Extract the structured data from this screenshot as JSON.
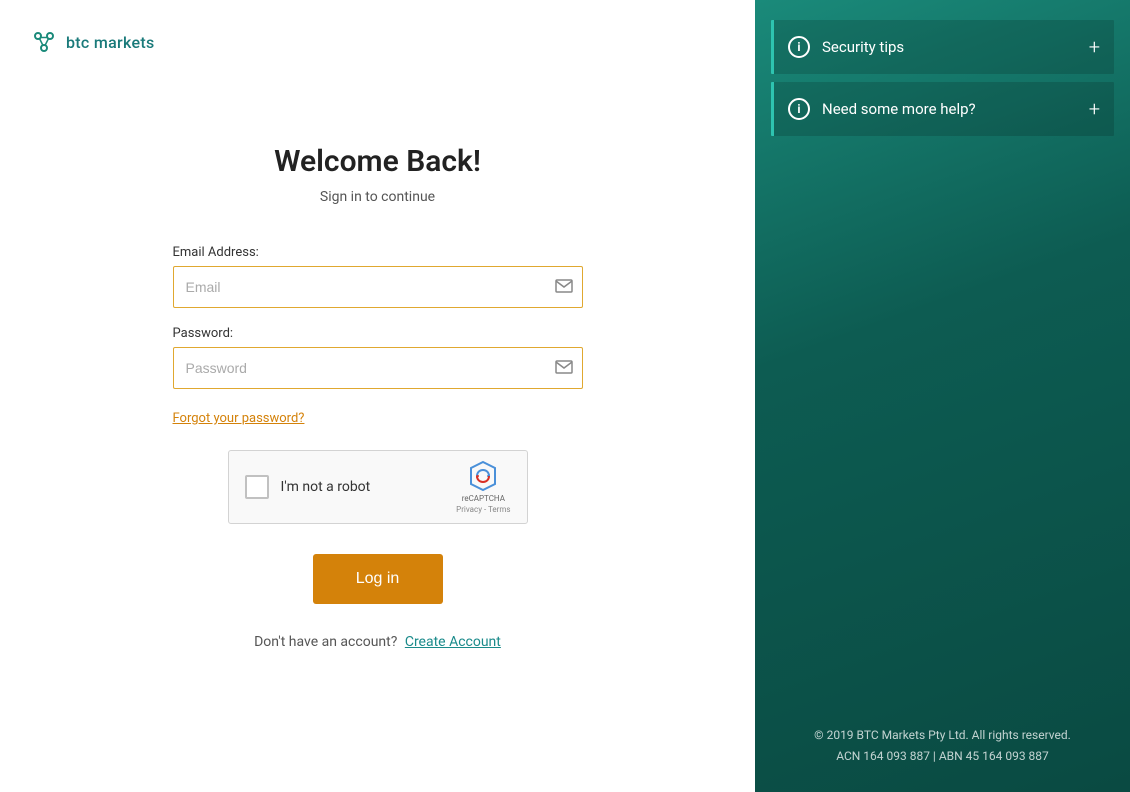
{
  "logo": {
    "text": "btc markets"
  },
  "form": {
    "title": "Welcome Back!",
    "subtitle": "Sign in to continue",
    "email_label": "Email Address:",
    "email_placeholder": "Email",
    "password_label": "Password:",
    "password_placeholder": "Password",
    "forgot_password": "Forgot your password?",
    "recaptcha_label": "I'm not a robot",
    "recaptcha_brand": "reCAPTCHA",
    "recaptcha_policy": "Privacy - Terms",
    "login_button": "Log in",
    "no_account_text": "Don't have an account?",
    "create_account_link": "Create Account"
  },
  "sidebar": {
    "security_tips_label": "Security tips",
    "help_label": "Need some more help?"
  },
  "footer": {
    "line1": "© 2019 BTC Markets Pty Ltd. All rights reserved.",
    "line2": "ACN 164 093 887 | ABN 45 164 093 887"
  },
  "colors": {
    "accent_orange": "#d4820a",
    "accent_teal": "#1a8a7a",
    "border_teal": "#2ec4b0"
  }
}
